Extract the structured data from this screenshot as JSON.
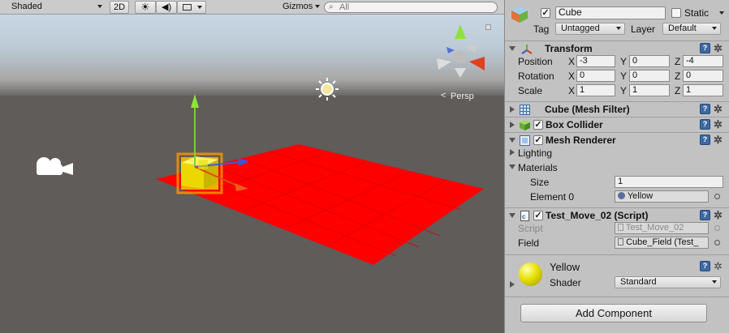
{
  "toolbar": {
    "shading_mode": "Shaded",
    "mode_2d": "2D",
    "gizmos_label": "Gizmos",
    "search_placeholder": "All"
  },
  "scene": {
    "projection_label": "Persp"
  },
  "inspector": {
    "object_name": "Cube",
    "active_checked": true,
    "static_label": "Static",
    "tag_label": "Tag",
    "tag_value": "Untagged",
    "layer_label": "Layer",
    "layer_value": "Default",
    "transform": {
      "title": "Transform",
      "position_label": "Position",
      "rotation_label": "Rotation",
      "scale_label": "Scale",
      "axis_x": "X",
      "axis_y": "Y",
      "axis_z": "Z",
      "position": {
        "x": "-3",
        "y": "0",
        "z": "-4"
      },
      "rotation": {
        "x": "0",
        "y": "0",
        "z": "0"
      },
      "scale": {
        "x": "1",
        "y": "1",
        "z": "1"
      }
    },
    "mesh_filter_title": "Cube (Mesh Filter)",
    "box_collider_title": "Box Collider",
    "mesh_renderer": {
      "title": "Mesh Renderer",
      "lighting_label": "Lighting",
      "materials_label": "Materials",
      "size_label": "Size",
      "size_value": "1",
      "element0_label": "Element 0",
      "element0_value": "Yellow"
    },
    "script_component": {
      "title": "Test_Move_02 (Script)",
      "script_label": "Script",
      "script_value": "Test_Move_02",
      "field_label": "Field",
      "field_value": "Cube_Field (Test_"
    },
    "material": {
      "name": "Yellow",
      "shader_label": "Shader",
      "shader_value": "Standard"
    },
    "add_component_label": "Add Component"
  },
  "colors": {
    "plane": "#ff0000",
    "cube": "#f2e600",
    "help_icon": "#3d6aa4"
  }
}
